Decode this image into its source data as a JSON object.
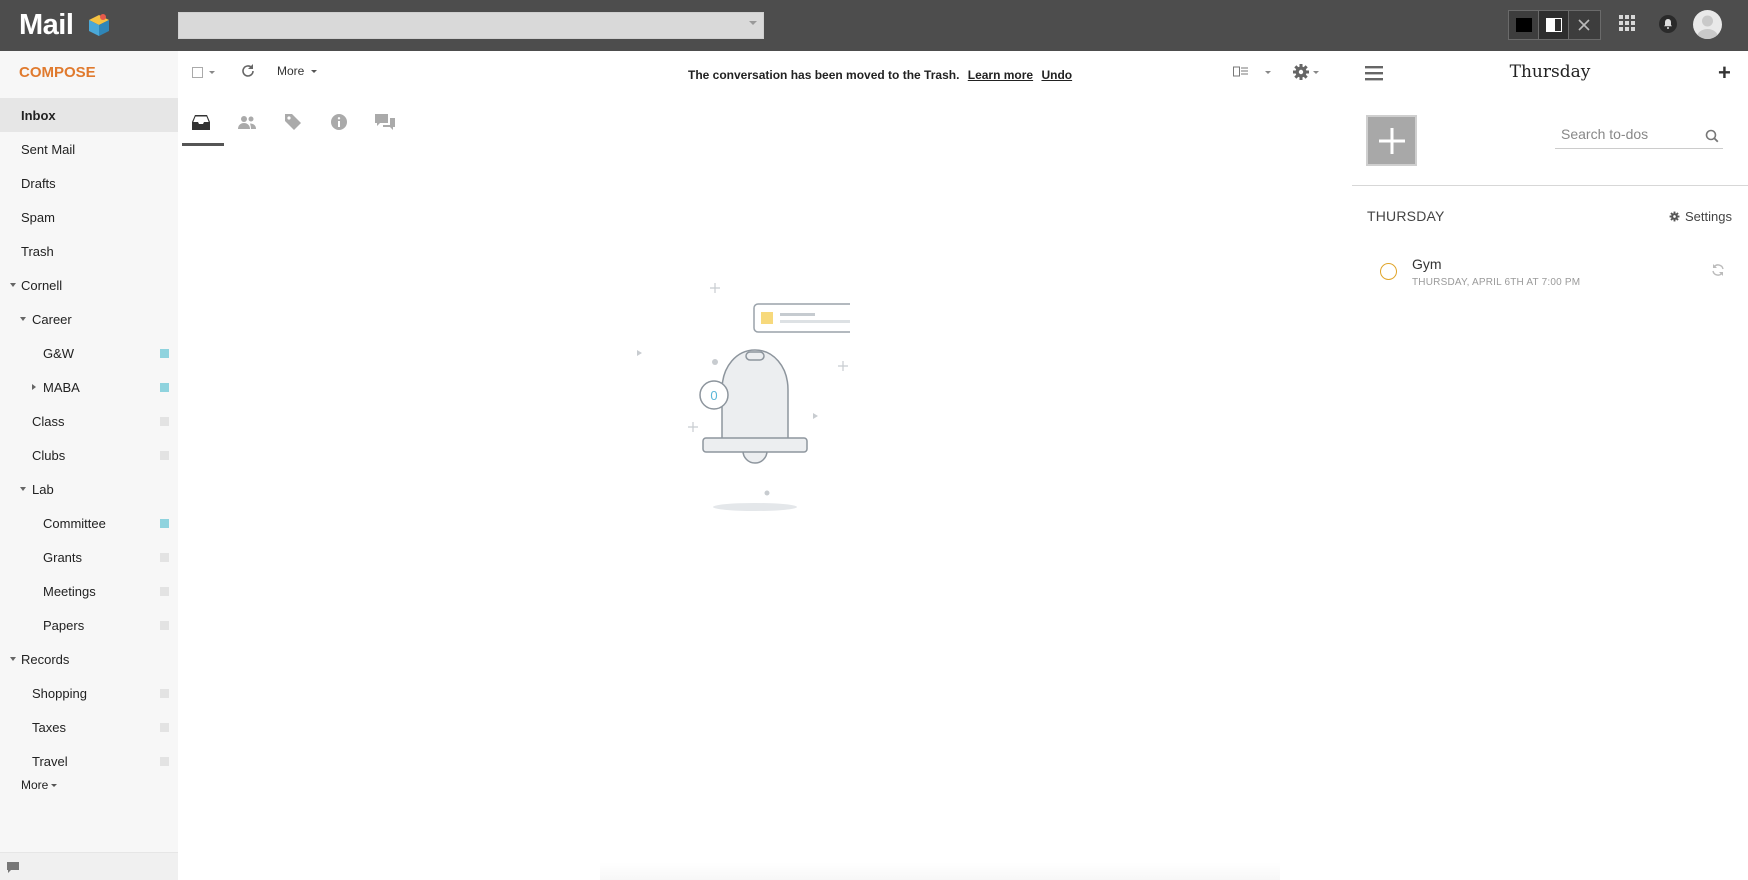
{
  "app": {
    "title": "Mail"
  },
  "search": {
    "placeholder": ""
  },
  "sidebar": {
    "compose_label": "COMPOSE",
    "items": [
      {
        "label": "Inbox",
        "active": true
      },
      {
        "label": "Sent Mail"
      },
      {
        "label": "Drafts"
      },
      {
        "label": "Spam"
      },
      {
        "label": "Trash"
      },
      {
        "label": "Cornell"
      },
      {
        "label": "Career"
      },
      {
        "label": "G&W"
      },
      {
        "label": "MABA"
      },
      {
        "label": "Class"
      },
      {
        "label": "Clubs"
      },
      {
        "label": "Lab"
      },
      {
        "label": "Committee"
      },
      {
        "label": "Grants"
      },
      {
        "label": "Meetings"
      },
      {
        "label": "Papers"
      },
      {
        "label": "Records"
      },
      {
        "label": "Shopping"
      },
      {
        "label": "Taxes"
      },
      {
        "label": "Travel"
      }
    ],
    "more_label": "More"
  },
  "toolbar": {
    "more_label": "More",
    "notice": "The conversation has been moved to the Trash.",
    "learn_more": "Learn more",
    "undo": "Undo"
  },
  "tabs": [
    "inbox-icon",
    "people-icon",
    "tag-icon",
    "info-icon",
    "chat-icon"
  ],
  "empty_state": {
    "count": "0"
  },
  "todo_panel": {
    "title": "Thursday",
    "search_placeholder": "Search to-dos",
    "day_heading": "THURSDAY",
    "settings_label": "Settings",
    "items": [
      {
        "name": "Gym",
        "date": "THURSDAY, APRIL 6TH AT 7:00 PM"
      }
    ]
  },
  "colors": {
    "topbar": "#4d4d4d",
    "compose": "#e07a2e",
    "label_teal": "#8fd3de",
    "todo_circle": "#e0a52a"
  }
}
